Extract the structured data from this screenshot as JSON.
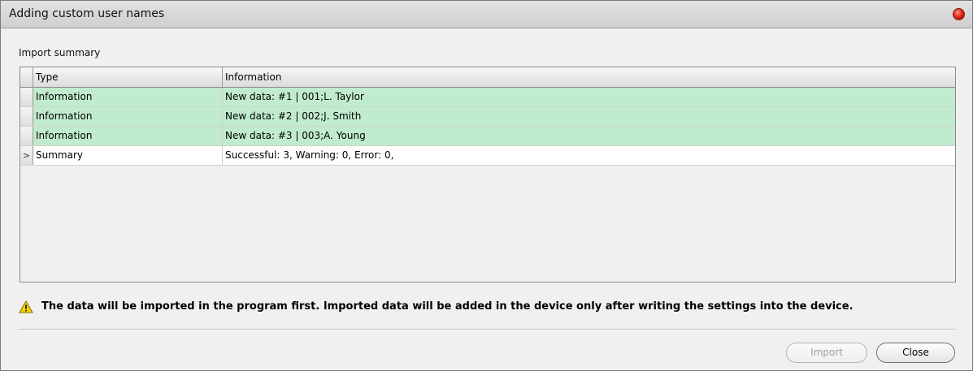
{
  "window": {
    "title": "Adding custom user names"
  },
  "import_summary": {
    "label": "Import summary",
    "columns": [
      "Type",
      "Information"
    ],
    "rows": [
      {
        "type": "Information",
        "info": "New data: #1 | 001;L. Taylor",
        "status": "success"
      },
      {
        "type": "Information",
        "info": "New data: #2 | 002;J. Smith",
        "status": "success"
      },
      {
        "type": "Information",
        "info": "New data: #3 | 003;A. Young",
        "status": "success"
      },
      {
        "type": "Summary",
        "info": "Successful: 3, Warning: 0, Error: 0,",
        "status": "summary",
        "current_row_marker": ">"
      }
    ]
  },
  "warning": {
    "icon": "warning-icon",
    "text": "The data will be imported in the program first. Imported data will be added in the device only after writing the settings into the device."
  },
  "buttons": {
    "import": "Import",
    "close": "Close"
  },
  "colors": {
    "success_row": "#c0eccd",
    "title_bar": "#d8d8d8",
    "close_orb": "#e02a1a"
  }
}
